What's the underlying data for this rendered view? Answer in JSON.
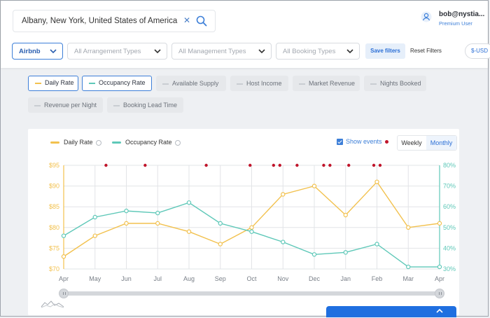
{
  "search": {
    "value": "Albany, New York, United States of America",
    "clear_icon": "close-icon",
    "search_icon": "search-icon"
  },
  "user": {
    "name": "bob@nystia...",
    "plan": "Premium User",
    "icon": "user-icon"
  },
  "filters": {
    "platform": "Airbnb",
    "arrangement": "All Arrangement Types",
    "management": "All Management Types",
    "booking": "All Booking Types",
    "save_label": "Save filters",
    "reset_label": "Reset Filters",
    "currency": "$-USD"
  },
  "metrics": [
    {
      "label": "Daily Rate",
      "active": true,
      "color": "#f2c14e"
    },
    {
      "label": "Occupancy Rate",
      "active": true,
      "color": "#5ec8b8"
    },
    {
      "label": "Available Supply",
      "active": false
    },
    {
      "label": "Host Income",
      "active": false
    },
    {
      "label": "Market Revenue",
      "active": false
    },
    {
      "label": "Nights Booked",
      "active": false
    },
    {
      "label": "Revenue per Night",
      "active": false
    },
    {
      "label": "Booking Lead Time",
      "active": false
    }
  ],
  "chart_controls": {
    "show_events": "Show events",
    "weekly": "Weekly",
    "monthly": "Monthly",
    "selected": "Monthly"
  },
  "chart_data": {
    "type": "line",
    "categories": [
      "Apr",
      "May",
      "Jun",
      "Jul",
      "Aug",
      "Sep",
      "Oct",
      "Nov",
      "Dec",
      "Jan",
      "Feb",
      "Mar",
      "Apr"
    ],
    "series": [
      {
        "name": "Daily Rate",
        "axis": "left",
        "color": "#f2c14e",
        "values": [
          73,
          78,
          81,
          81,
          79,
          76,
          80,
          88,
          90,
          83,
          91,
          80,
          81
        ]
      },
      {
        "name": "Occupancy Rate",
        "axis": "right",
        "color": "#5ec8b8",
        "values": [
          46,
          55,
          58,
          57,
          62,
          52,
          48,
          43,
          37,
          38,
          42,
          31,
          31
        ]
      }
    ],
    "left_axis": {
      "ticks": [
        "$70",
        "$75",
        "$80",
        "$85",
        "$90",
        "$95"
      ],
      "ylim": [
        70,
        95
      ]
    },
    "right_axis": {
      "ticks": [
        "30%",
        "40%",
        "50%",
        "60%",
        "70%",
        "80%"
      ],
      "ylim": [
        30,
        80
      ]
    },
    "events": [
      1.35,
      2.6,
      4.55,
      5.95,
      6.7,
      6.9,
      7.45,
      8.3,
      8.5,
      9.1,
      9.9,
      10.1
    ],
    "grid": true,
    "legend_position": "top-left",
    "event_color": "#c0152b"
  }
}
